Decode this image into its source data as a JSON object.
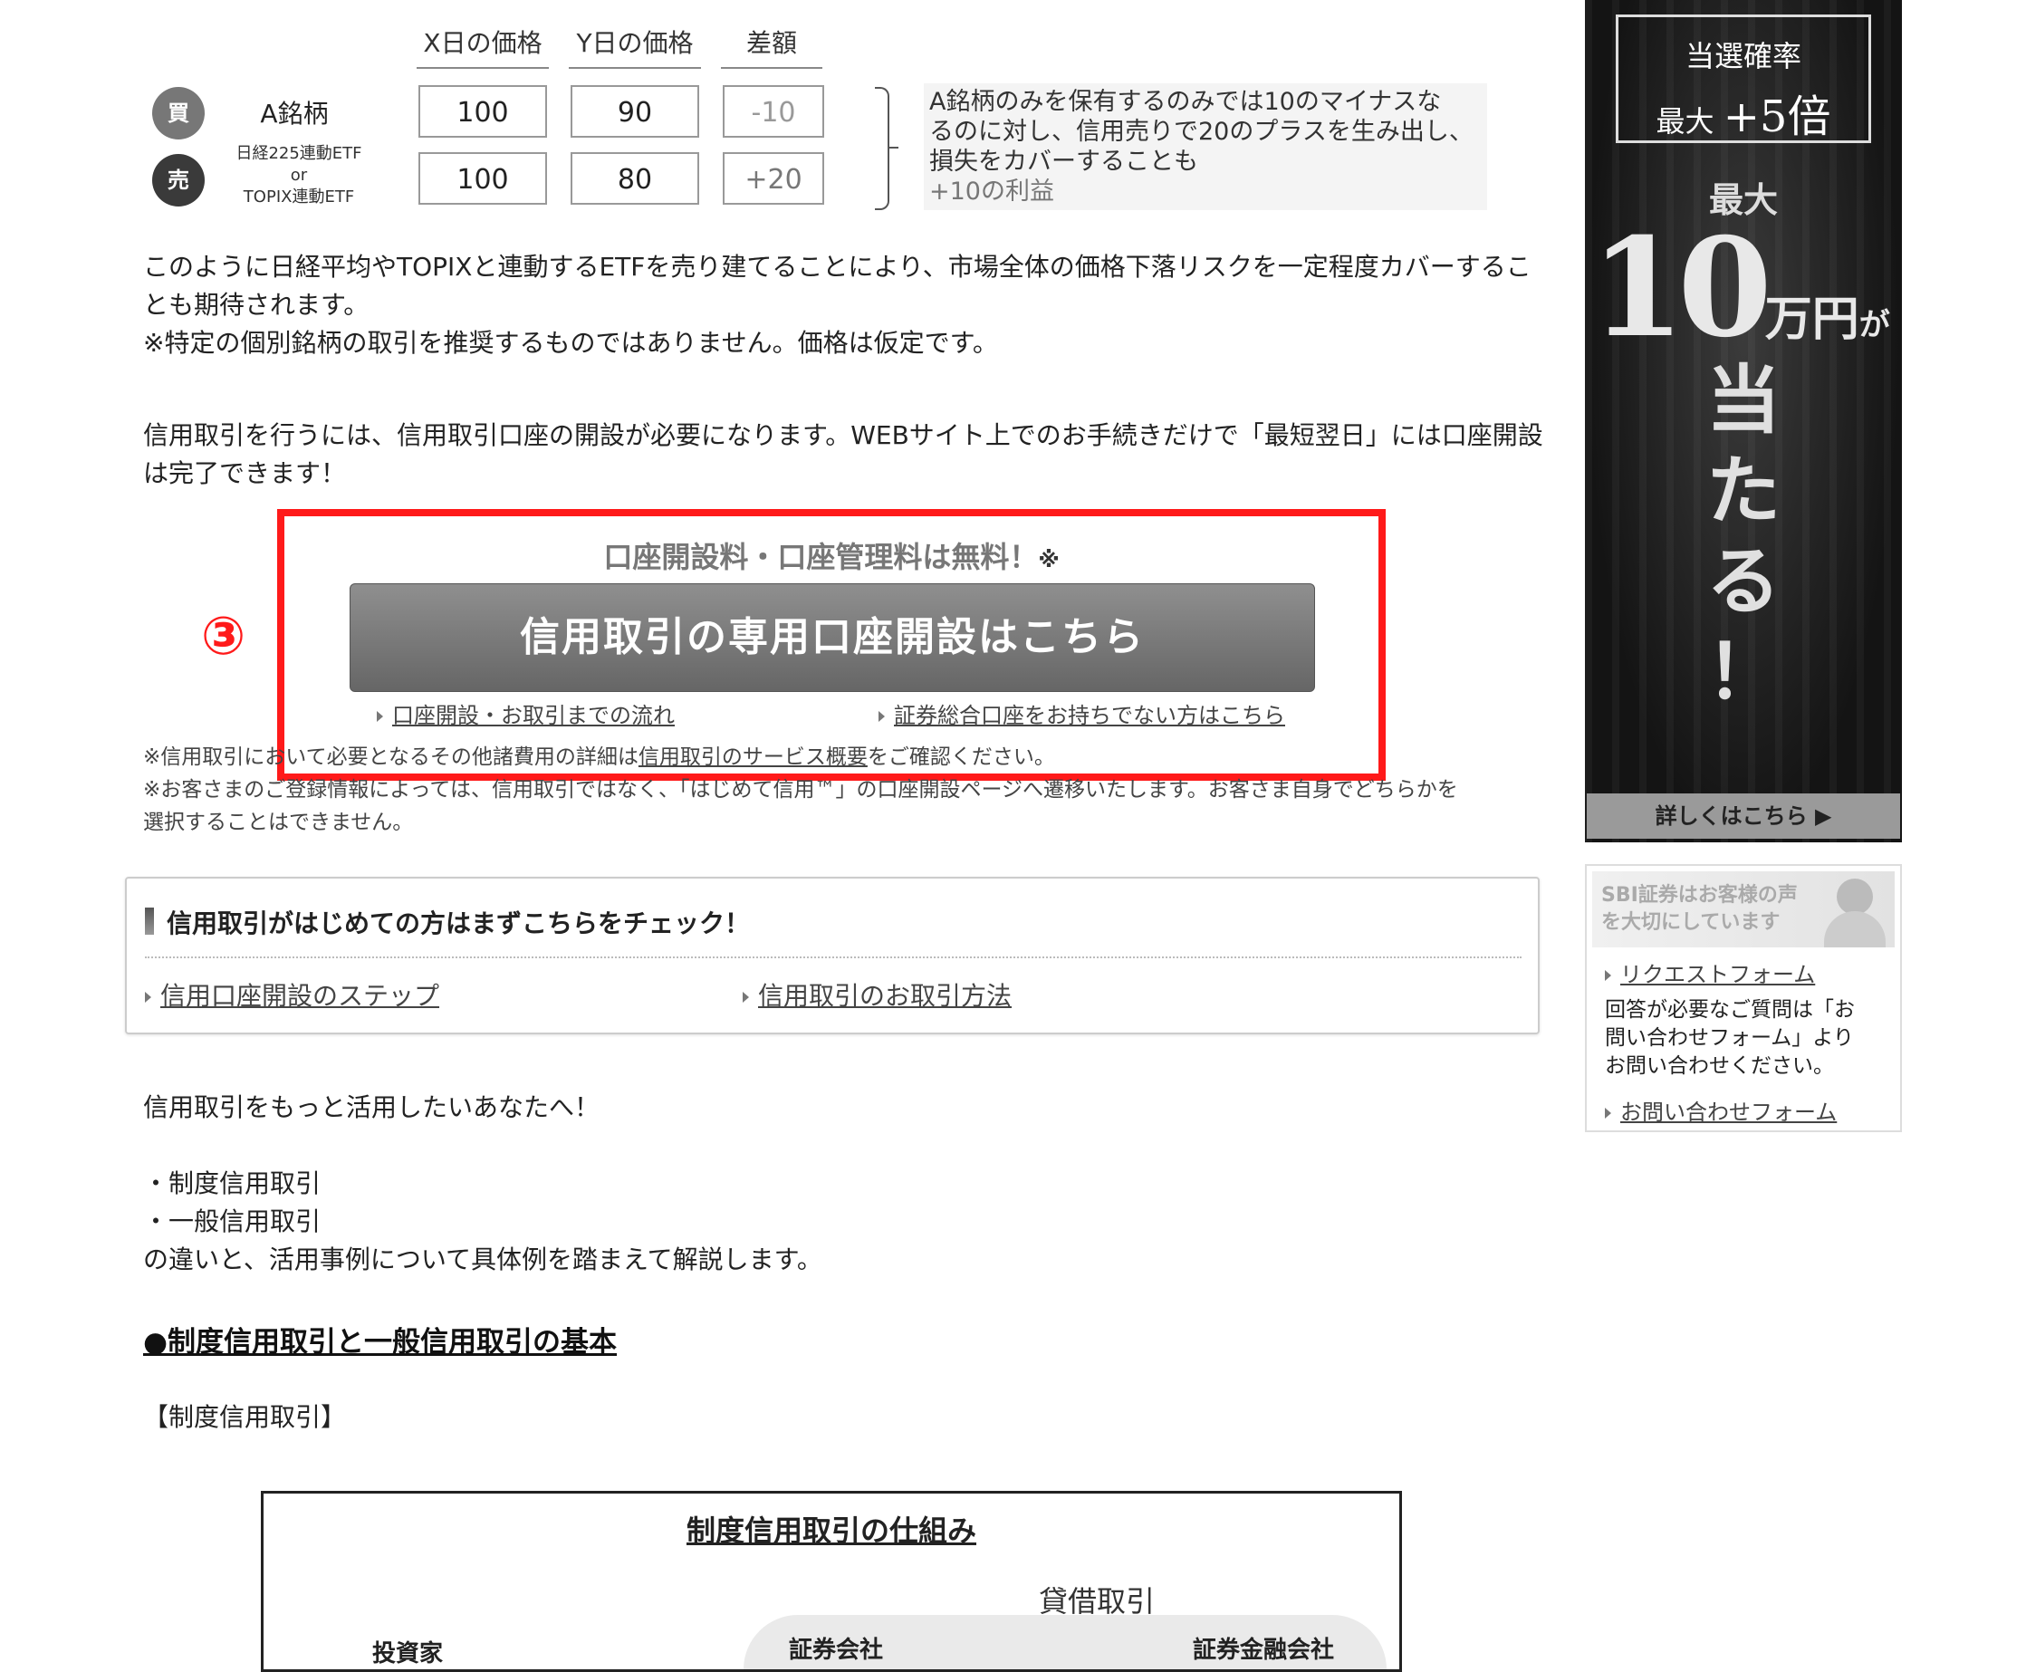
{
  "hedge_table": {
    "headers": [
      "X日の価格",
      "Y日の価格",
      "差額"
    ],
    "rows": [
      {
        "badge": "買",
        "badge_color": "#777777",
        "name": "A銘柄",
        "x": "100",
        "y": "90",
        "diff": "-10"
      },
      {
        "badge": "売",
        "badge_color": "#3a3a3a",
        "name_line1": "日経225連動ETF",
        "name_line2": "or",
        "name_line3": "TOPIX連動ETF",
        "x": "100",
        "y": "80",
        "diff": "+20"
      }
    ],
    "note_lines": [
      "A銘柄のみを保有するのみでは10のマイナスな",
      "るのに対し、信用売りで20のプラスを生み出し、",
      "損失をカバーすることも",
      "+10の利益"
    ]
  },
  "paragraphs": {
    "p1_line1": "このように日経平均やTOPIXと連動するETFを売り建てることにより、市場全体の価格下落リスクを一定程度カバーするこ",
    "p1_line2": "とも期待されます。",
    "p1_note": "※特定の個別銘柄の取引を推奨するものではありません。価格は仮定です。",
    "p2_line1": "信用取引を行うには、信用取引口座の開設が必要になります。WEBサイト上でのお手続きだけで「最短翌日」には口座開設",
    "p2_line2": "は完了できます！"
  },
  "cta": {
    "marker": "③",
    "fee_text": "口座開設料・口座管理料は無料！",
    "fee_mark": "※",
    "button_label": "信用取引の専用口座開設はこちら",
    "link1": "口座開設・お取引までの流れ",
    "link2": "証券総合口座をお持ちでない方はこちら",
    "accent_color": "#ff1a1a"
  },
  "notes": {
    "n1_before": "※信用取引において必要となるその他諸費用の詳細は",
    "n1_link": "信用取引のサービス概要",
    "n1_after": "をご確認ください。",
    "n2_line1": "※お客さまのご登録情報によっては、信用取引ではなく、「はじめて信用™」の口座開設ページへ遷移いたします。お客さま自身でどちらかを",
    "n2_line2": "選択することはできません。"
  },
  "check_box": {
    "title": "信用取引がはじめての方はまずこちらをチェック！",
    "link1": "信用口座開設のステップ",
    "link2": "信用取引のお取引方法"
  },
  "section2": {
    "intro": "信用取引をもっと活用したいあなたへ！",
    "item1": "・制度信用取引",
    "item2": "・一般信用取引",
    "desc": "の違いと、活用事例について具体例を踏まえて解説します。",
    "heading": "●制度信用取引と一般信用取引の基本",
    "bracket_label": "【制度信用取引】"
  },
  "diagram": {
    "title": "制度信用取引の仕組み",
    "subtitle": "貸借取引",
    "node1": "投資家",
    "node2": "証券会社",
    "node3": "証券金融会社"
  },
  "sidebar": {
    "banner": {
      "frame_line1": "当選確率",
      "frame_line2_prefix": "最大 ",
      "frame_line2_value": "+5倍",
      "max_label": "最大",
      "amount_number": "10",
      "amount_unit": "万円",
      "amount_particle": "が",
      "win_chars": [
        "当",
        "た",
        "る",
        "！"
      ],
      "details_button": "詳しくはこちら ▶"
    },
    "voice": {
      "header_line1": "SBI証券はお客様の声",
      "header_line2": "を大切にしています",
      "request_link": "リクエストフォーム",
      "text_line1": "回答が必要なご質問は「お",
      "text_line2": "問い合わせフォーム」より",
      "text_line3": "お問い合わせください。",
      "contact_link": "お問い合わせフォーム"
    }
  }
}
